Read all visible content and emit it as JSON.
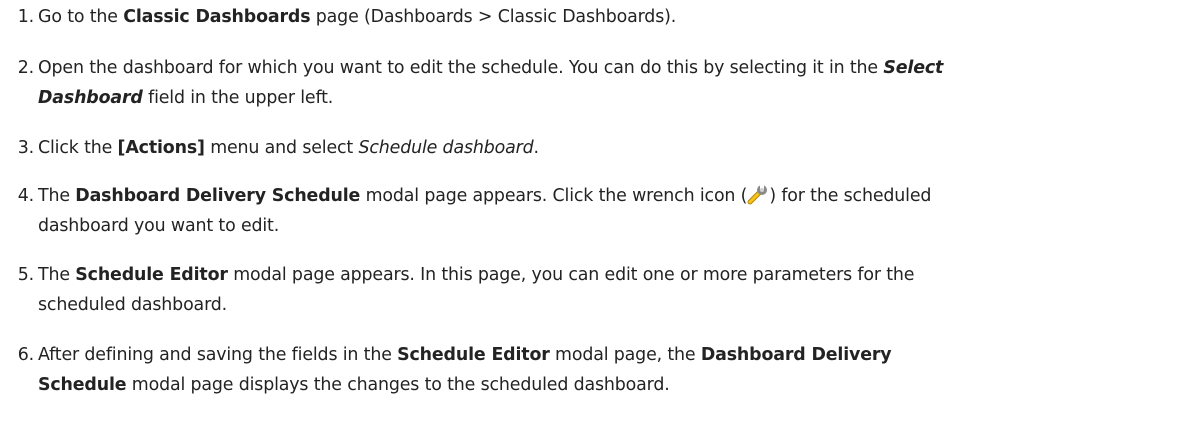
{
  "steps": [
    {
      "num": "1.",
      "a": "Go to the ",
      "b": "Classic Dashboards",
      "c": " page (Dashboards > Classic Dashboards)."
    },
    {
      "num": "2.",
      "a": "Open the dashboard for which you want to edit the schedule. You can do this by selecting it in the ",
      "b": "Select",
      "b2": "Dashboard",
      "c": " field in the upper left."
    },
    {
      "num": "3.",
      "a": "Click the ",
      "b": "[Actions]",
      "c": " menu and select ",
      "d": "Schedule dashboard",
      "e": "."
    },
    {
      "num": "4.",
      "a": "The ",
      "b": "Dashboard Delivery Schedule",
      "c": " modal page appears. Click the wrench icon (",
      "d": ") for the scheduled",
      "e": "dashboard you want to edit."
    },
    {
      "num": "5.",
      "a": "The ",
      "b": "Schedule Editor",
      "c": " modal page appears. In this page, you can edit one or more parameters for the",
      "d": "scheduled dashboard."
    },
    {
      "num": "6.",
      "a": "After defining and saving the fields in the ",
      "b": "Schedule Editor",
      "c": " modal page, the ",
      "d": "Dashboard Delivery",
      "e": "Schedule",
      "f": " modal page displays the changes to the scheduled dashboard."
    }
  ],
  "icons": {
    "wrench": "wrench-icon"
  }
}
